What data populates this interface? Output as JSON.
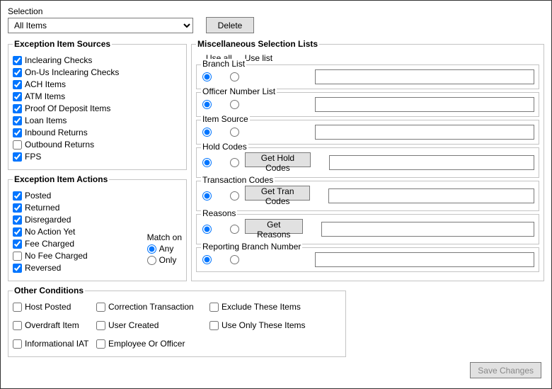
{
  "selection": {
    "label": "Selection",
    "value": "All Items",
    "delete_label": "Delete"
  },
  "exception_sources": {
    "legend": "Exception Item Sources",
    "items": [
      {
        "label": "Inclearing Checks",
        "checked": true
      },
      {
        "label": "On-Us Inclearing Checks",
        "checked": true
      },
      {
        "label": "ACH Items",
        "checked": true
      },
      {
        "label": "ATM Items",
        "checked": true
      },
      {
        "label": "Proof Of Deposit Items",
        "checked": true
      },
      {
        "label": "Loan Items",
        "checked": true
      },
      {
        "label": "Inbound Returns",
        "checked": true
      },
      {
        "label": "Outbound Returns",
        "checked": false
      },
      {
        "label": "FPS",
        "checked": true
      }
    ]
  },
  "exception_actions": {
    "legend": "Exception Item Actions",
    "items": [
      {
        "label": "Posted",
        "checked": true
      },
      {
        "label": "Returned",
        "checked": true
      },
      {
        "label": "Disregarded",
        "checked": true
      },
      {
        "label": "No Action Yet",
        "checked": true
      },
      {
        "label": "Fee Charged",
        "checked": true
      },
      {
        "label": "No Fee Charged",
        "checked": false
      },
      {
        "label": "Reversed",
        "checked": true
      }
    ],
    "match_on": {
      "label": "Match on",
      "options": [
        {
          "label": "Any",
          "selected": true
        },
        {
          "label": "Only",
          "selected": false
        }
      ]
    }
  },
  "misc": {
    "legend": "Miscellaneous Selection Lists",
    "header": {
      "use_all": "Use all",
      "use_list": "Use list"
    },
    "groups": [
      {
        "key": "branch",
        "label": "Branch List",
        "use_all": true,
        "button": null,
        "value": ""
      },
      {
        "key": "officer",
        "label": "Officer Number List",
        "use_all": true,
        "button": null,
        "value": ""
      },
      {
        "key": "itemsource",
        "label": "Item Source",
        "use_all": true,
        "button": null,
        "value": ""
      },
      {
        "key": "holdcodes",
        "label": "Hold Codes",
        "use_all": true,
        "button": "Get Hold Codes",
        "value": ""
      },
      {
        "key": "trancodes",
        "label": "Transaction Codes",
        "use_all": true,
        "button": "Get Tran Codes",
        "value": ""
      },
      {
        "key": "reasons",
        "label": "Reasons",
        "use_all": true,
        "button": "Get Reasons",
        "value": ""
      },
      {
        "key": "repbranch",
        "label": "Reporting Branch Number",
        "use_all": true,
        "button": null,
        "value": ""
      }
    ]
  },
  "other": {
    "legend": "Other Conditions",
    "items": [
      {
        "label": "Host Posted",
        "checked": false
      },
      {
        "label": "Correction Transaction",
        "checked": false
      },
      {
        "label": "Exclude These Items",
        "checked": false
      },
      {
        "label": "Overdraft Item",
        "checked": false
      },
      {
        "label": "User Created",
        "checked": false
      },
      {
        "label": "Use Only These Items",
        "checked": false
      },
      {
        "label": "Informational IAT",
        "checked": false
      },
      {
        "label": "Employee Or Officer",
        "checked": false
      }
    ]
  },
  "save_label": "Save Changes"
}
